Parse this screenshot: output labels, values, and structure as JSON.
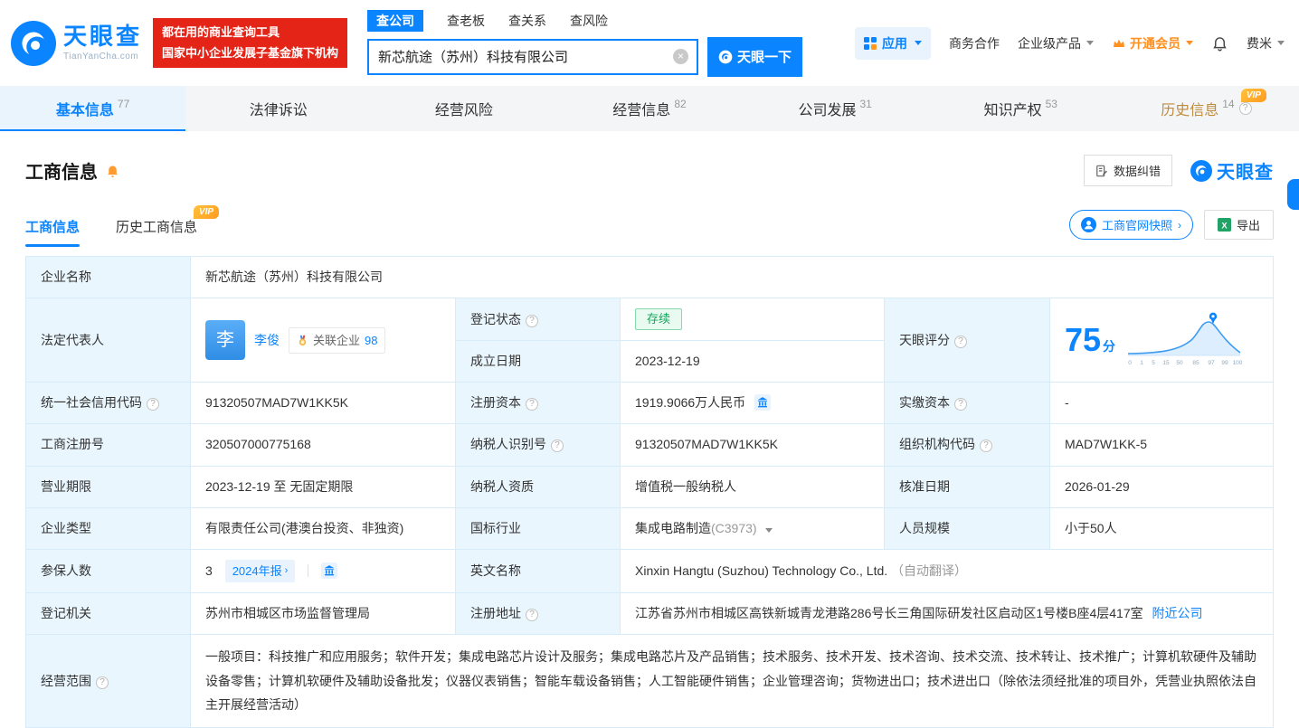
{
  "brand": {
    "name": "天眼查",
    "domain": "TianYanCha.com",
    "slogan_line1": "都在用的商业查询工具",
    "slogan_line2": "国家中小企业发展子基金旗下机构"
  },
  "search": {
    "tabs": [
      {
        "label": "查公司"
      },
      {
        "label": "查老板"
      },
      {
        "label": "查关系"
      },
      {
        "label": "查风险"
      }
    ],
    "value": "新芯航途（苏州）科技有限公司",
    "button_label": "天眼一下"
  },
  "topnav": {
    "app_label": "应用",
    "business_label": "商务合作",
    "enterprise_label": "企业级产品",
    "vip_label": "开通会员",
    "user_label": "费米"
  },
  "vip_badge": "VIP",
  "nav_tabs": [
    {
      "label": "基本信息",
      "count": "77"
    },
    {
      "label": "法律诉讼",
      "count": ""
    },
    {
      "label": "经营风险",
      "count": ""
    },
    {
      "label": "经营信息",
      "count": "82"
    },
    {
      "label": "公司发展",
      "count": "31"
    },
    {
      "label": "知识产权",
      "count": "53"
    },
    {
      "label": "历史信息",
      "count": "14"
    }
  ],
  "section": {
    "title": "工商信息",
    "correction_label": "数据纠错",
    "watermark": "天眼查",
    "subtab_current": "工商信息",
    "subtab_history": "历史工商信息",
    "snapshot_label": "工商官网快照",
    "export_label": "导出"
  },
  "fields": {
    "company_name_label": "企业名称",
    "company_name": "新芯航途（苏州）科技有限公司",
    "legal_rep_label": "法定代表人",
    "legal_rep_avatar": "李",
    "legal_rep_name": "李俊",
    "related_company_label": "关联企业",
    "related_company_count": "98",
    "reg_status_label": "登记状态",
    "reg_status": "存续",
    "score_label": "天眼评分",
    "score_value": "75",
    "score_unit": "分",
    "score_axis": [
      "0",
      "1",
      "5",
      "15",
      "50",
      "85",
      "97",
      "99",
      "100"
    ],
    "est_date_label": "成立日期",
    "est_date": "2023-12-19",
    "credit_code_label": "统一社会信用代码",
    "credit_code": "91320507MAD7W1KK5K",
    "reg_capital_label": "注册资本",
    "reg_capital": "1919.9066万人民币",
    "paid_capital_label": "实缴资本",
    "paid_capital": "-",
    "reg_number_label": "工商注册号",
    "reg_number": "320507000775168",
    "taxpayer_id_label": "纳税人识别号",
    "taxpayer_id": "91320507MAD7W1KK5K",
    "org_code_label": "组织机构代码",
    "org_code": "MAD7W1KK-5",
    "business_term_label": "营业期限",
    "business_term": "2023-12-19 至 无固定期限",
    "taxpayer_quality_label": "纳税人资质",
    "taxpayer_quality": "增值税一般纳税人",
    "approval_date_label": "核准日期",
    "approval_date": "2026-01-29",
    "company_type_label": "企业类型",
    "company_type": "有限责任公司(港澳台投资、非独资)",
    "industry_label": "国标行业",
    "industry": "集成电路制造",
    "industry_code": "(C3973)",
    "staff_size_label": "人员规模",
    "staff_size": "小于50人",
    "insured_label": "参保人数",
    "insured_count": "3",
    "annual_report": "2024年报",
    "english_name_label": "英文名称",
    "english_name": "Xinxin Hangtu (Suzhou) Technology Co., Ltd.",
    "auto_translate": "（自动翻译）",
    "reg_authority_label": "登记机关",
    "reg_authority": "苏州市相城区市场监督管理局",
    "reg_address_label": "注册地址",
    "reg_address": "江苏省苏州市相城区高铁新城青龙港路286号长三角国际研发社区启动区1号楼B座4层417室",
    "nearby_label": "附近公司",
    "business_scope_label": "经营范围",
    "business_scope": "一般项目：科技推广和应用服务；软件开发；集成电路芯片设计及服务；集成电路芯片及产品销售；技术服务、技术开发、技术咨询、技术交流、技术转让、技术推广；计算机软硬件及辅助设备零售；计算机软硬件及辅助设备批发；仪器仪表销售；智能车载设备销售；人工智能硬件销售；企业管理咨询；货物进出口；技术进出口（除依法须经批准的项目外，凭营业执照依法自主开展经营活动）"
  },
  "colors": {
    "primary": "#0b84ff",
    "red": "#e32417",
    "vip_orange": "#ff8f1f",
    "green": "#12a75c"
  }
}
